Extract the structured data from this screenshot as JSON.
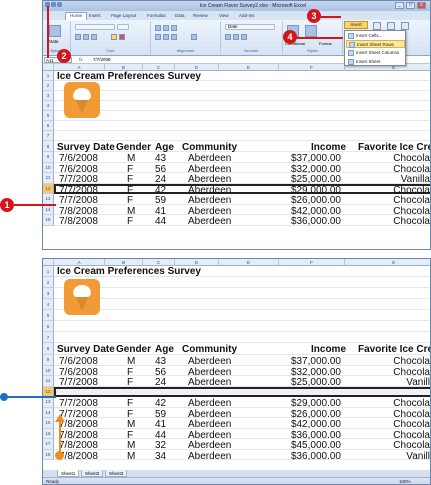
{
  "window": {
    "title": "Ice Cream Flavor Survey2.xlsx - Microsoft Excel",
    "min": "_",
    "max": "□",
    "close": "x"
  },
  "ribbon_tabs": [
    "Home",
    "Insert",
    "Page Layout",
    "Formulas",
    "Data",
    "Review",
    "View",
    "Add-Ins"
  ],
  "ribbon": {
    "paste_label": "Paste",
    "clipboard_label": "Clipboard",
    "font_label": "Font",
    "alignment_label": "Alignment",
    "number_label": "Number",
    "number_format": "Date",
    "styles_label": "Styles",
    "insert_button": "Insert",
    "format_label": "Format",
    "conditional_label": "Conditional"
  },
  "insert_menu": {
    "items": [
      "Insert Cells...",
      "Insert Sheet Rows",
      "Insert Sheet Columns",
      "Insert Sheet"
    ],
    "selected_index": 1
  },
  "formula_bar": {
    "name_box": "A11",
    "fx": "fx",
    "value": "7/7/2008"
  },
  "columns": [
    "A",
    "B",
    "C",
    "D",
    "E",
    "F",
    "G"
  ],
  "sheet_title": "Ice Cream Preferences Survey",
  "headers": {
    "survey_date": "Survey Date",
    "gender": "Gender",
    "age": "Age",
    "community": "Community",
    "income": "Income",
    "favorite": "Favorite Ice Cre"
  },
  "top_rows": [
    {
      "n": "9",
      "date": "7/6/2008",
      "gender": "M",
      "age": "43",
      "community": "Aberdeen",
      "income": "$37,000.00",
      "fav": "Chocola"
    },
    {
      "n": "10",
      "date": "7/6/2008",
      "gender": "F",
      "age": "56",
      "community": "Aberdeen",
      "income": "$32,000.00",
      "fav": "Chocola"
    },
    {
      "n": "11",
      "date": "7/7/2008",
      "gender": "F",
      "age": "24",
      "community": "Aberdeen",
      "income": "$25,000.00",
      "fav": "Vanilla"
    },
    {
      "n": "12",
      "date": "7/7/2008",
      "gender": "F",
      "age": "42",
      "community": "Aberdeen",
      "income": "$29,000.00",
      "fav": "Chocola"
    },
    {
      "n": "13",
      "date": "7/7/2008",
      "gender": "F",
      "age": "59",
      "community": "Aberdeen",
      "income": "$26,000.00",
      "fav": "Chocola"
    },
    {
      "n": "14",
      "date": "7/8/2008",
      "gender": "M",
      "age": "41",
      "community": "Aberdeen",
      "income": "$42,000.00",
      "fav": "Chocola"
    },
    {
      "n": "15",
      "date": "7/8/2008",
      "gender": "F",
      "age": "44",
      "community": "Aberdeen",
      "income": "$36,000.00",
      "fav": "Chocola"
    }
  ],
  "bottom_rows": [
    {
      "n": "9",
      "date": "7/6/2008",
      "gender": "M",
      "age": "43",
      "community": "Aberdeen",
      "income": "$37,000.00",
      "fav": "Chocola"
    },
    {
      "n": "10",
      "date": "7/6/2008",
      "gender": "F",
      "age": "56",
      "community": "Aberdeen",
      "income": "$32,000.00",
      "fav": "Chocola"
    },
    {
      "n": "11",
      "date": "7/7/2008",
      "gender": "F",
      "age": "24",
      "community": "Aberdeen",
      "income": "$25,000.00",
      "fav": "Vanill"
    },
    {
      "n": "12",
      "date": "",
      "gender": "",
      "age": "",
      "community": "",
      "income": "",
      "fav": ""
    },
    {
      "n": "13",
      "date": "7/7/2008",
      "gender": "F",
      "age": "42",
      "community": "Aberdeen",
      "income": "$29,000.00",
      "fav": "Chocola"
    },
    {
      "n": "14",
      "date": "7/7/2008",
      "gender": "F",
      "age": "59",
      "community": "Aberdeen",
      "income": "$26,000.00",
      "fav": "Chocola"
    },
    {
      "n": "15",
      "date": "7/8/2008",
      "gender": "M",
      "age": "41",
      "community": "Aberdeen",
      "income": "$42,000.00",
      "fav": "Chocola"
    },
    {
      "n": "16",
      "date": "7/8/2008",
      "gender": "F",
      "age": "44",
      "community": "Aberdeen",
      "income": "$36,000.00",
      "fav": "Chocola"
    },
    {
      "n": "17",
      "date": "7/8/2008",
      "gender": "M",
      "age": "32",
      "community": "Aberdeen",
      "income": "$45,000.00",
      "fav": "Chocola"
    },
    {
      "n": "18",
      "date": "7/8/2008",
      "gender": "M",
      "age": "34",
      "community": "Aberdeen",
      "income": "$36,000.00",
      "fav": "Vanill"
    }
  ],
  "sheet_tabs": [
    "Sheet1",
    "Sheet2",
    "Sheet3"
  ],
  "status": {
    "ready": "Ready",
    "zoom": "100%"
  },
  "callouts": {
    "c1": "1",
    "c2": "2",
    "c3": "3",
    "c4": "4"
  },
  "colors": {
    "red": "#d3151c",
    "blue": "#1f6fc4",
    "orange": "#f08c1e"
  }
}
